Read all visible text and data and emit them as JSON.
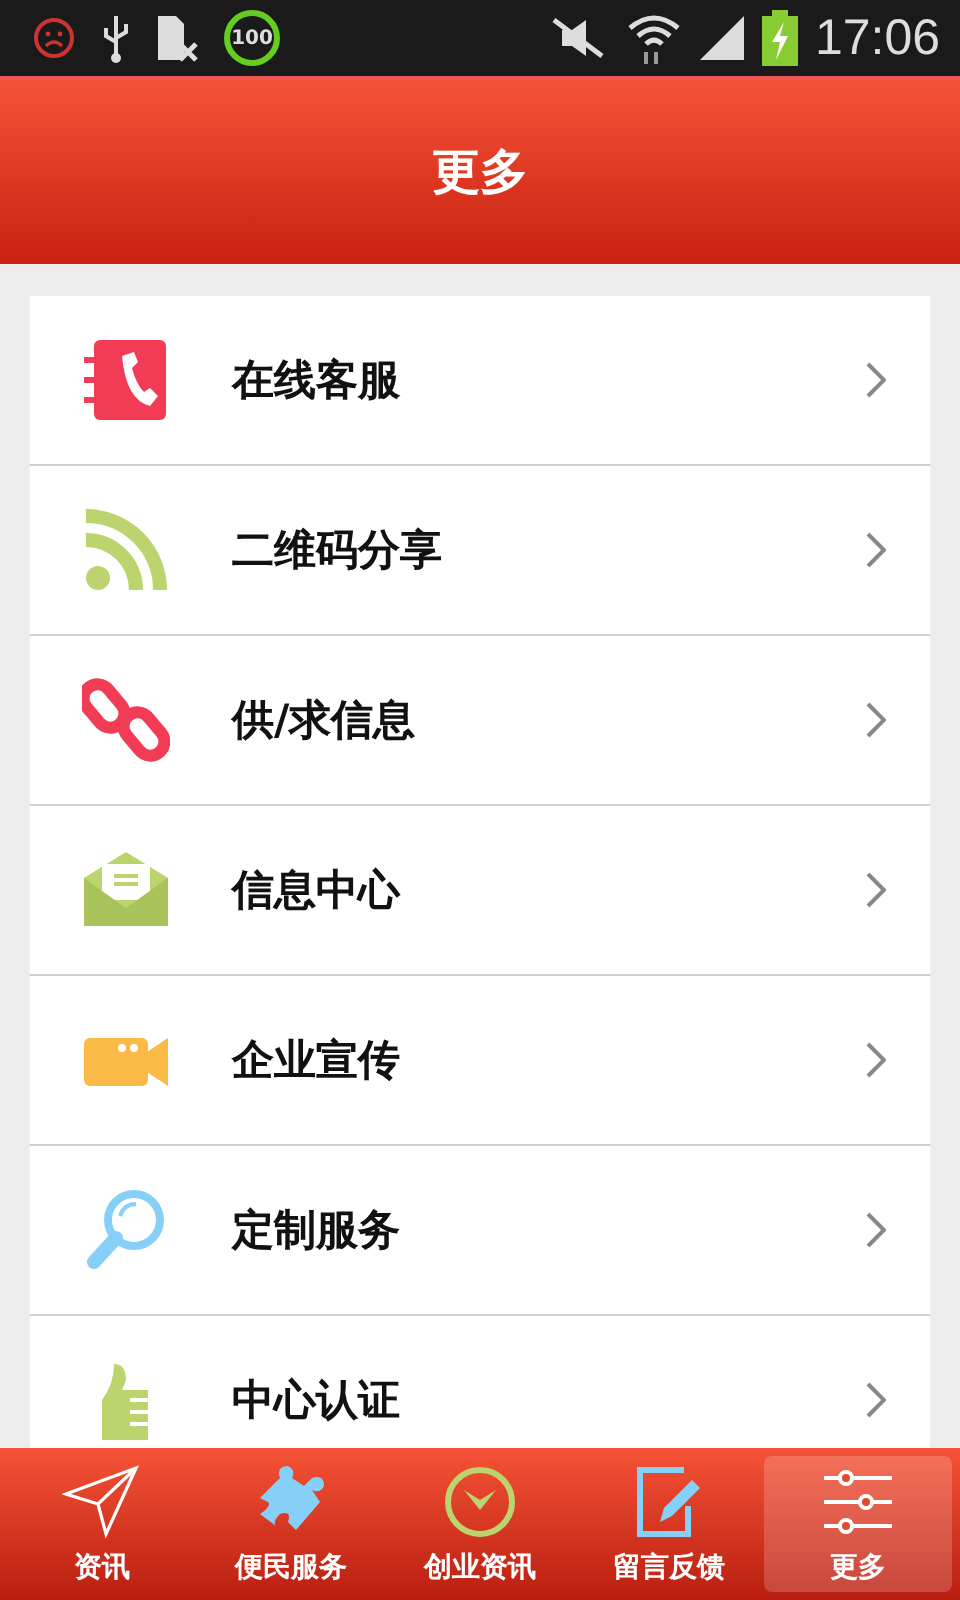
{
  "status_bar": {
    "badge": "100",
    "time": "17:06"
  },
  "header": {
    "title": "更多"
  },
  "menu": [
    {
      "kind": "phone",
      "label": "在线客服"
    },
    {
      "kind": "rss",
      "label": "二维码分享"
    },
    {
      "kind": "link",
      "label": "供/求信息"
    },
    {
      "kind": "mail",
      "label": "信息中心"
    },
    {
      "kind": "video",
      "label": "企业宣传"
    },
    {
      "kind": "search",
      "label": "定制服务"
    },
    {
      "kind": "thumb",
      "label": "中心认证"
    }
  ],
  "tab_bar": [
    {
      "kind": "send",
      "label": "资讯",
      "selected": false
    },
    {
      "kind": "puzzle",
      "label": "便民服务",
      "selected": false
    },
    {
      "kind": "clock",
      "label": "创业资讯",
      "selected": false
    },
    {
      "kind": "edit",
      "label": "留言反馈",
      "selected": false
    },
    {
      "kind": "sliders",
      "label": "更多",
      "selected": true
    }
  ]
}
